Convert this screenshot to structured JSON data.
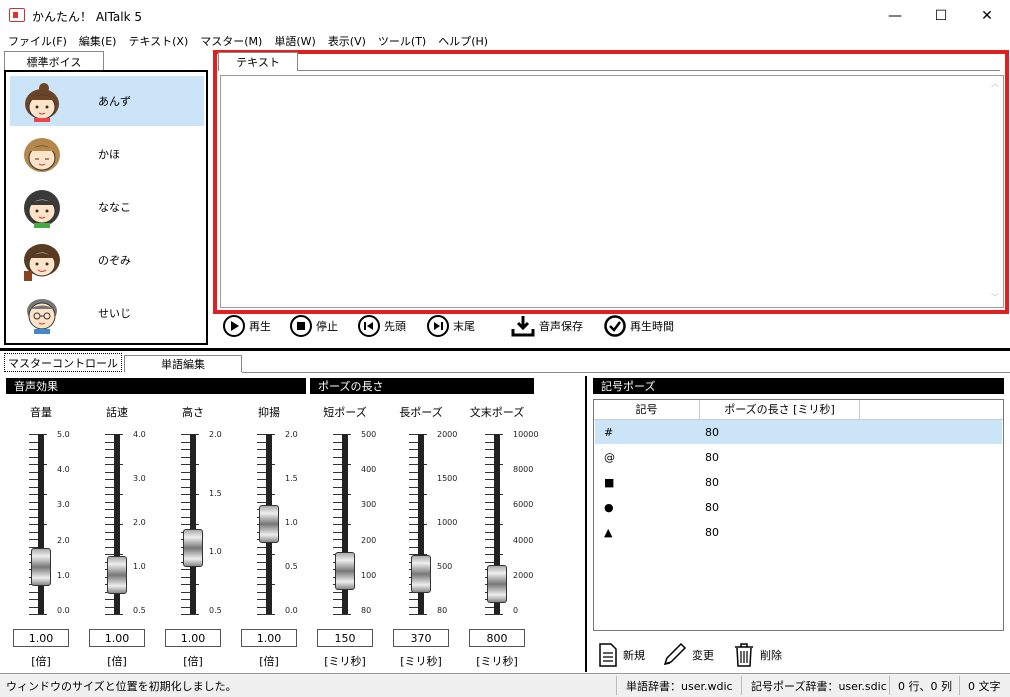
{
  "window": {
    "title": "かんたん！ AITalk 5",
    "controls": [
      "—",
      "☐",
      "✕"
    ]
  },
  "menu": [
    "ファイル(F)",
    "編集(E)",
    "テキスト(X)",
    "マスター(M)",
    "単語(W)",
    "表示(V)",
    "ツール(T)",
    "ヘルプ(H)"
  ],
  "voice_tab": "標準ボイス",
  "text_tab": "テキスト",
  "voices": [
    {
      "name": "あんず",
      "hair": "#6b4326"
    },
    {
      "name": "かほ",
      "hair": "#b5874a"
    },
    {
      "name": "ななこ",
      "hair": "#3a3a3a"
    },
    {
      "name": "のぞみ",
      "hair": "#5a3a20"
    },
    {
      "name": "せいじ",
      "hair": "#777777"
    }
  ],
  "playback": {
    "play": "再生",
    "stop": "停止",
    "start": "先頭",
    "end": "末尾",
    "save": "音声保存",
    "time": "再生時間"
  },
  "bottom_tabs": [
    "マスターコントロール",
    "単語編集"
  ],
  "sections": {
    "effects": "音声効果",
    "pause": "ポーズの長さ",
    "symbol_pause": "記号ポーズ"
  },
  "sliders": [
    {
      "label": "音量",
      "value": "1.00",
      "unit": "[倍]",
      "ticks": [
        "5.0",
        "4.0",
        "3.0",
        "2.0",
        "1.0",
        "0.0"
      ],
      "level": 0.2
    },
    {
      "label": "話速",
      "value": "1.00",
      "unit": "[倍]",
      "ticks": [
        "4.0",
        "3.0",
        "2.0",
        "1.0",
        "0.5"
      ],
      "level": 0.14
    },
    {
      "label": "高さ",
      "value": "1.00",
      "unit": "[倍]",
      "ticks": [
        "2.0",
        "1.5",
        "1.0",
        "0.5"
      ],
      "level": 0.33
    },
    {
      "label": "抑揚",
      "value": "1.00",
      "unit": "[倍]",
      "ticks": [
        "2.0",
        "1.5",
        "1.0",
        "0.5",
        "0.0"
      ],
      "level": 0.5
    },
    {
      "label": "短ポーズ",
      "value": "150",
      "unit": "[ミリ秒]",
      "ticks": [
        "500",
        "400",
        "300",
        "200",
        "100",
        "80"
      ],
      "level": 0.17
    },
    {
      "label": "長ポーズ",
      "value": "370",
      "unit": "[ミリ秒]",
      "ticks": [
        "2000",
        "1500",
        "1000",
        "500",
        "80"
      ],
      "level": 0.15
    },
    {
      "label": "文末ポーズ",
      "value": "800",
      "unit": "[ミリ秒]",
      "ticks": [
        "10000",
        "8000",
        "6000",
        "4000",
        "2000",
        "0"
      ],
      "level": 0.08
    }
  ],
  "symbol_table": {
    "headers": [
      "記号",
      "ポーズの長さ [ミリ秒]"
    ],
    "rows": [
      {
        "symbol": "#",
        "value": "80"
      },
      {
        "symbol": "@",
        "value": "80"
      },
      {
        "symbol": "■",
        "value": "80"
      },
      {
        "symbol": "●",
        "value": "80"
      },
      {
        "symbol": "▲",
        "value": "80"
      }
    ]
  },
  "symbol_actions": {
    "new": "新規",
    "edit": "変更",
    "delete": "削除"
  },
  "status": {
    "message": "ウィンドウのサイズと位置を初期化しました。",
    "word_dict": "単語辞書：user.wdic",
    "symbol_dict": "記号ポーズ辞書：user.sdic",
    "position": "0 行、0 列",
    "chars": "0 文字"
  }
}
